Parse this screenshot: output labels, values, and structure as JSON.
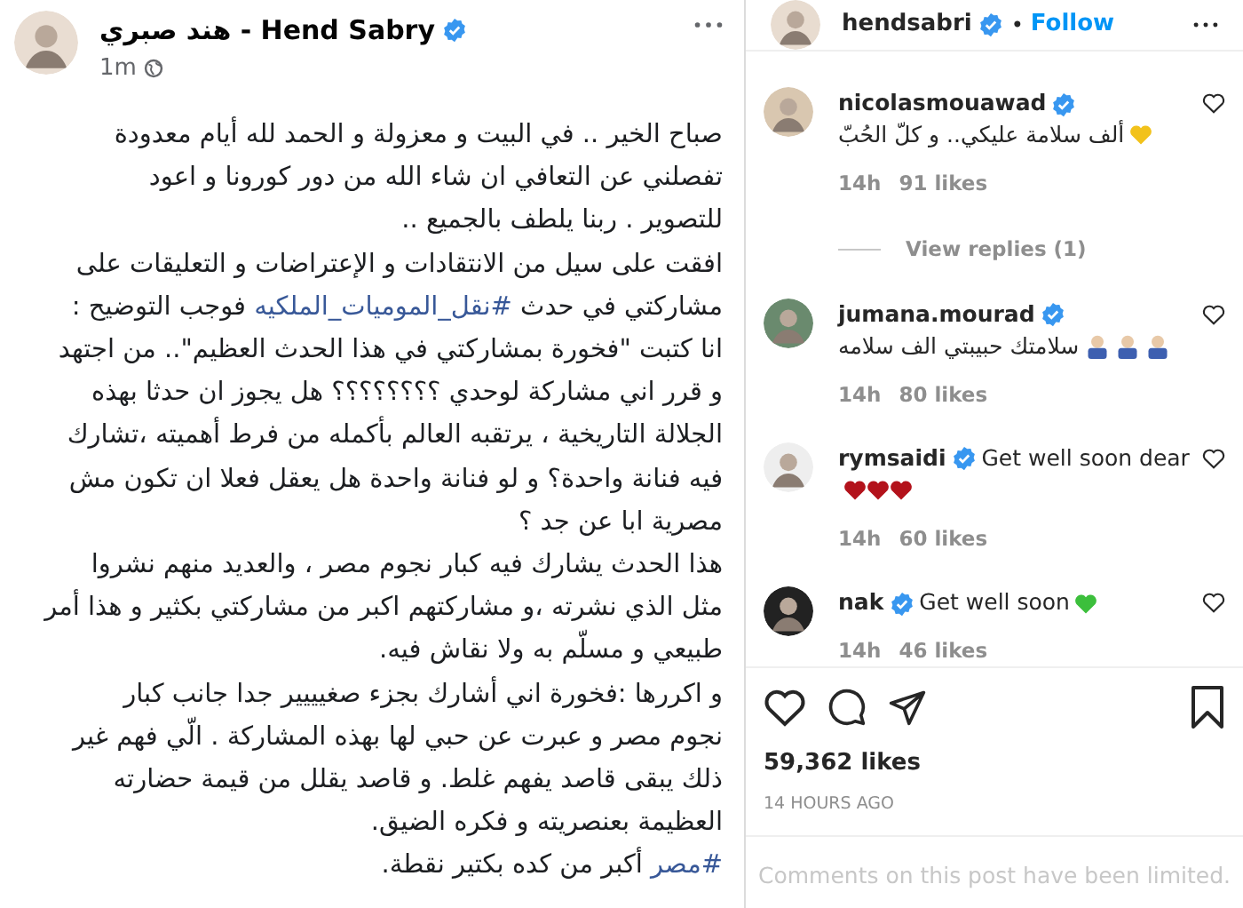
{
  "facebook_post": {
    "author": "هند صبري - Hend Sabry",
    "verified": true,
    "time": "1m",
    "lines": [
      [
        {
          "text": "صباح الخير .. في البيت و معزولة و الحمد لله  أيام معدودة"
        }
      ],
      [
        {
          "text": "تفصلني عن التعافي ان شاء الله من دور كورونا و اعود"
        }
      ],
      [
        {
          "text": "للتصوير . ربنا يلطف بالجميع .."
        }
      ],
      [
        {
          "text": "افقت على سيل من الانتقادات و الإعتراضات و التعليقات على"
        }
      ],
      [
        {
          "text": "مشاركتي في حدث "
        },
        {
          "text": "#نقل_الموميات_الملكيه",
          "kind": "hashtag"
        },
        {
          "text": " فوجب التوضيح :"
        }
      ],
      [
        {
          "text": "انا كتبت \"فخورة بمشاركتي في هذا الحدث العظيم\".. من اجتهد"
        }
      ],
      [
        {
          "text": "و قرر اني مشاركة لوحدي ؟؟؟؟؟؟؟؟ هل يجوز ان حدثا بهذه"
        }
      ],
      [
        {
          "text": "الجلالة التاريخية ، يرتقبه العالم بأكمله من فرط أهميته ،تشارك"
        }
      ],
      [
        {
          "text": "فيه فنانة واحدة؟ و لو فنانة واحدة هل يعقل فعلا ان تكون مش"
        }
      ],
      [
        {
          "text": "مصرية ابا عن جد ؟"
        }
      ],
      [
        {
          "text": "هذا الحدث يشارك فيه كبار نجوم مصر ، والعديد منهم نشروا"
        }
      ],
      [
        {
          "text": "مثل الذي نشرته ،و مشاركتهم اكبر من مشاركتي بكثير و هذا أمر"
        }
      ],
      [
        {
          "text": "طبيعي و مسلّم به ولا نقاش فيه."
        }
      ],
      [
        {
          "text": "و اكررها :فخورة اني أشارك بجزء صغيييير جدا جانب كبار"
        }
      ],
      [
        {
          "text": "نجوم مصر و عبرت عن حبي لها بهذه المشاركة . الّي فهم غير"
        }
      ],
      [
        {
          "text": "ذلك يبقى قاصد يفهم غلط. و قاصد يقلل من قيمة حضارته"
        }
      ],
      [
        {
          "text": "العظيمة بعنصريته و فكره الضيق."
        }
      ],
      [
        {
          "text": "#مصر",
          "kind": "hashtag"
        },
        {
          "text": " أكبر من كده بكتير نقطة."
        }
      ]
    ]
  },
  "instagram": {
    "username": "hendsabri",
    "verified": true,
    "separator": "•",
    "follow": "Follow",
    "comments": [
      {
        "username": "nicolasmouawad",
        "verified": true,
        "text": "ألف سلامة عليكي.. و كلّ الحُبّ",
        "rtl": true,
        "emojis": [
          {
            "kind": "heart",
            "color": "#f2c21b"
          }
        ],
        "time": "14h",
        "likes": "91 likes",
        "replies": "View replies (1)"
      },
      {
        "username": "jumana.mourad",
        "verified": true,
        "text": "سلامتك حبيبتي الف سلامه",
        "rtl": true,
        "emojis": [
          {
            "kind": "person",
            "color": "#3d5fb0"
          },
          {
            "kind": "person",
            "color": "#3d5fb0"
          },
          {
            "kind": "person",
            "color": "#3d5fb0"
          }
        ],
        "time": "14h",
        "likes": "80 likes"
      },
      {
        "username": "rymsaidi",
        "verified": true,
        "text": "Get well soon dear",
        "rtl": false,
        "emojis": [
          {
            "kind": "heart",
            "color": "#b3121b"
          },
          {
            "kind": "heart",
            "color": "#b3121b"
          },
          {
            "kind": "heart",
            "color": "#b3121b"
          }
        ],
        "time": "14h",
        "likes": "60 likes"
      },
      {
        "username": "nak",
        "verified": true,
        "text": "Get well soon",
        "rtl": false,
        "emojis": [
          {
            "kind": "heart",
            "color": "#3cbf3c"
          }
        ],
        "time": "14h",
        "likes": "46 likes"
      }
    ],
    "likes": "59,362 likes",
    "posted": "14 HOURS AGO",
    "notice": "Comments on this post have been limited."
  }
}
